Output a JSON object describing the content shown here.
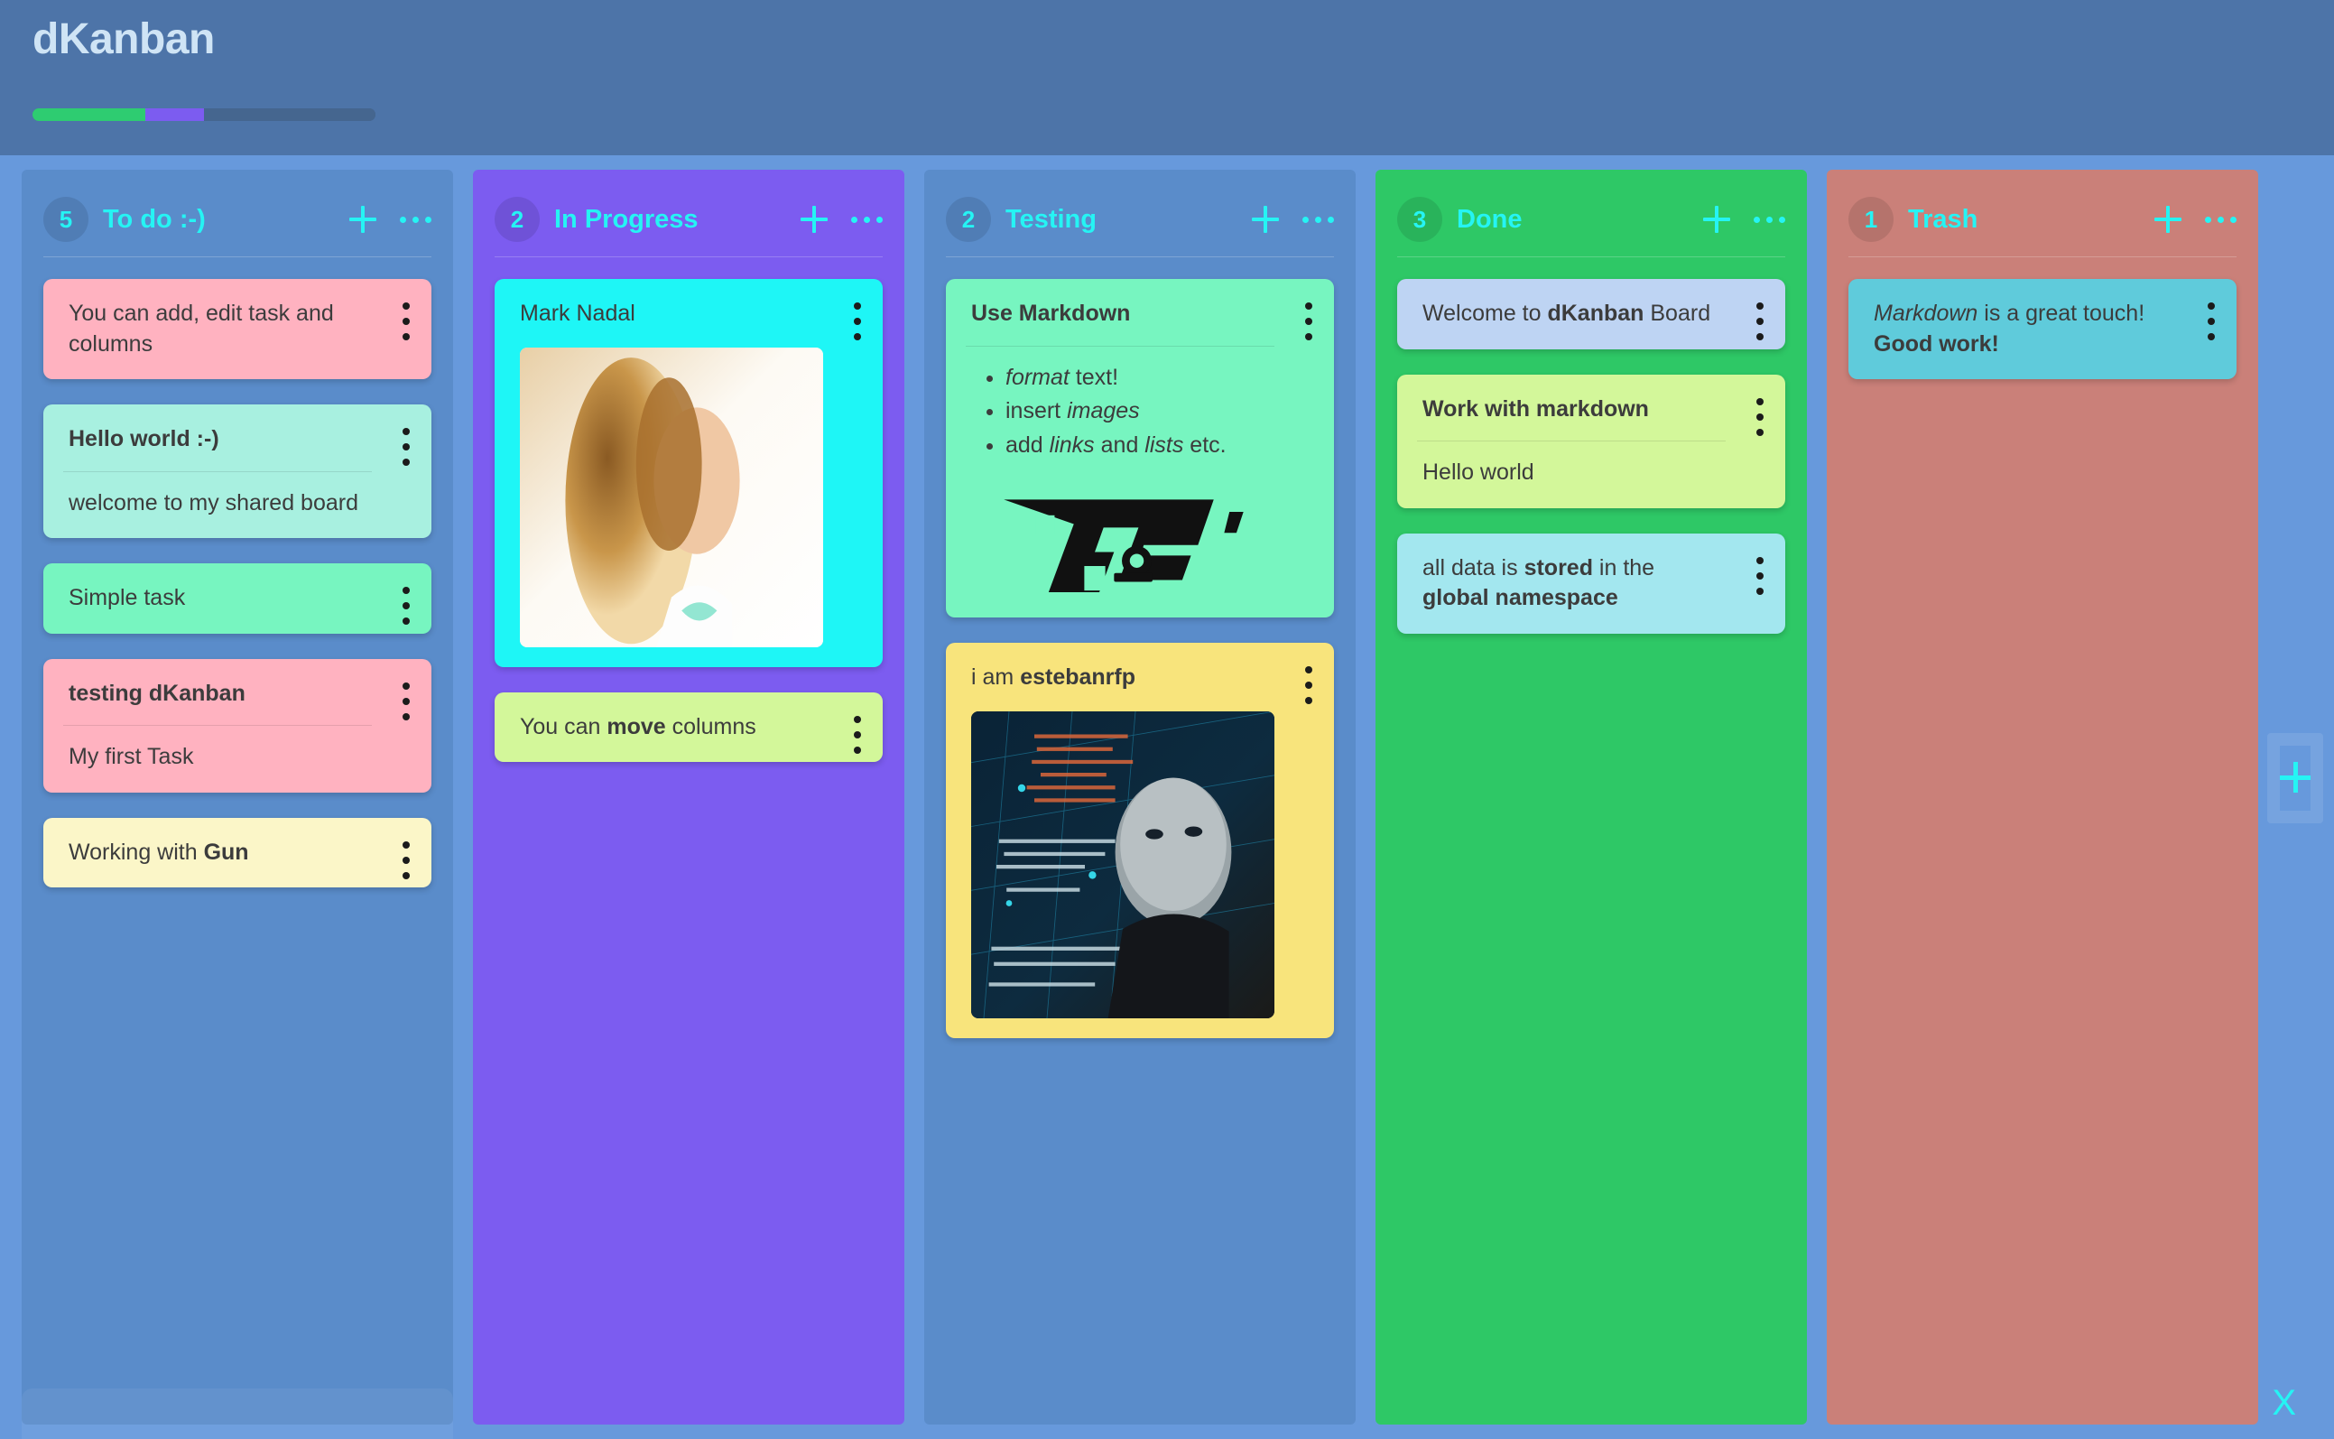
{
  "app": {
    "title": "dKanban",
    "progress": [
      {
        "color": "#2ecc71",
        "width_pct": 33
      },
      {
        "color": "#7c5cf0",
        "width_pct": 17
      },
      {
        "color": "#45668f",
        "width_pct": 50
      }
    ]
  },
  "icons": {
    "add_card": "plus-icon",
    "column_menu": "ellipsis-horizontal-icon",
    "card_menu": "ellipsis-vertical-icon",
    "add_column": "plus-icon",
    "close": "X"
  },
  "columns": [
    {
      "count": "5",
      "title": "To do :-)",
      "bg": "#5a8cca",
      "cards": [
        {
          "bg": "#ffb2c0",
          "title": "You can add, edit task and columns",
          "title_bold": false,
          "rule": false,
          "body": ""
        },
        {
          "bg": "#a8f0e0",
          "title": "Hello world :-)",
          "title_bold": true,
          "rule": true,
          "body": "welcome to my shared board"
        },
        {
          "bg": "#77f5c0",
          "title": "Simple task",
          "title_bold": false,
          "rule": false,
          "body": ""
        },
        {
          "bg": "#ffb2c0",
          "title": "testing dKanban",
          "title_bold": true,
          "rule": true,
          "body": "My first Task"
        },
        {
          "bg": "#fbf6c8",
          "title_html": "Working with <b>Gun</b>",
          "title_bold": false,
          "rule": false,
          "body": ""
        }
      ]
    },
    {
      "count": "2",
      "title": "In Progress",
      "bg": "#7c5cf0",
      "cards": [
        {
          "bg": "#1ef6f6",
          "title": "Mark Nadal",
          "title_bold": false,
          "rule": false,
          "body": "",
          "image": "photo-a",
          "image_alt": "portrait of smiling long-haired person with bow tie"
        },
        {
          "bg": "#d3f79a",
          "title_html": "You can <b>move</b> columns",
          "title_bold": false,
          "rule": false,
          "body": ""
        }
      ]
    },
    {
      "count": "2",
      "title": "Testing",
      "bg": "#5a8cca",
      "cards": [
        {
          "bg": "#77f5c0",
          "title": "Use Markdown",
          "title_bold": true,
          "rule": true,
          "list": [
            "<i>format</i> text!",
            "insert <i>images</i>",
            "add <i>links</i> and <i>lists</i> etc."
          ],
          "logo": "gun-logo"
        },
        {
          "bg": "#f8e47c",
          "title_html": "i am <b>estebanrfp</b>",
          "title_bold": false,
          "rule": false,
          "body": "",
          "image": "photo-b",
          "image_alt": "portrait over blue code matrix background"
        }
      ]
    },
    {
      "count": "3",
      "title": "Done",
      "bg": "#2ec866",
      "cards": [
        {
          "bg": "#bed4f3",
          "title_html": "Welcome to <b>dKanban</b> Board",
          "title_bold": false,
          "rule": false,
          "body": ""
        },
        {
          "bg": "#d3f79a",
          "title": "Work with markdown",
          "title_bold": true,
          "rule": true,
          "body": "Hello world"
        },
        {
          "bg": "#a3e7ef",
          "title_html": "all data is <b>stored</b> in the <b>global namespace</b>",
          "title_bold": false,
          "rule": false,
          "body": ""
        }
      ]
    },
    {
      "count": "1",
      "title": "Trash",
      "bg": "#ca8079",
      "cards": [
        {
          "bg": "#5fcbdb",
          "title_html": "<i>Markdown</i> is a great touch!",
          "title_bold": false,
          "rule": false,
          "body_html": "<b>Good work!</b>"
        }
      ]
    }
  ]
}
